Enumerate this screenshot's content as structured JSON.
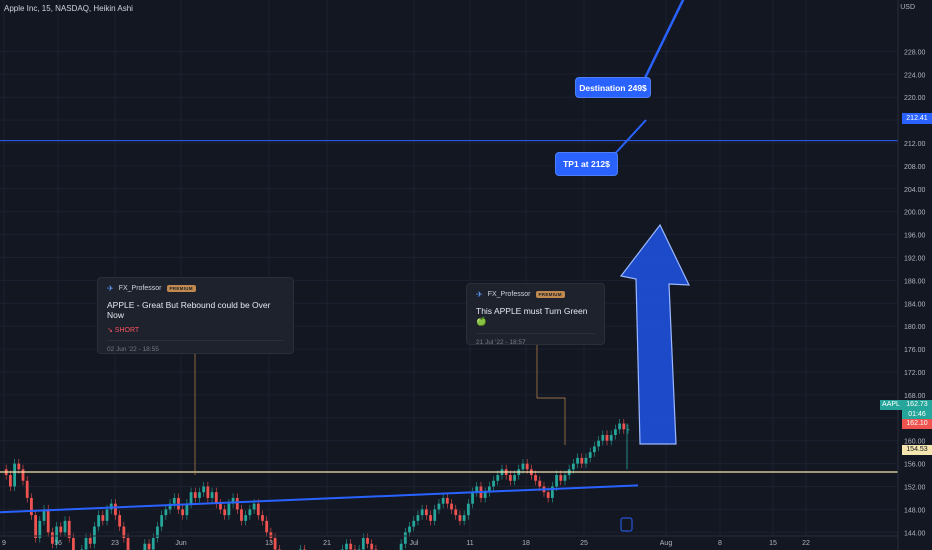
{
  "header": {
    "title": "Apple Inc, 15, NASDAQ, Heikin Ashi",
    "currency": "USD"
  },
  "colors": {
    "background": "#131722",
    "up": "#26a69a",
    "down": "#ef5350",
    "trendline": "#2962ff",
    "arrow": "#1e53e5",
    "support": "#f5e6b0",
    "level": "#2962ff"
  },
  "callouts": [
    {
      "author": "FX_Professor",
      "badge": "PREMIUM",
      "title": "APPLE - Great But Rebound could be Over Now",
      "signal": "↘ SHORT",
      "date": "02 Jun '22 - 18:55"
    },
    {
      "author": "FX_Professor",
      "badge": "PREMIUM",
      "title": "This APPLE must Turn Green 🍏",
      "signal": "",
      "date": "21 Jul '22 - 18:57"
    }
  ],
  "annotations": {
    "destination": "Destination 249$",
    "tp1": "TP1 at 212$"
  },
  "price_tags": {
    "level": "212.41",
    "symbol": "AAPL",
    "last": "162.73",
    "countdown": "01:46",
    "prev": "162.10",
    "support": "154.53"
  },
  "chart_data": {
    "type": "candlestick",
    "style": "Heikin Ashi",
    "symbol": "AAPL",
    "timeframe": "15",
    "exchange": "NASDAQ",
    "y_axis_ticks": [
      228,
      224,
      220,
      216,
      212,
      208,
      204,
      200,
      196,
      192,
      188,
      184,
      180,
      176,
      172,
      168,
      164,
      160,
      156,
      152,
      148,
      144,
      140
    ],
    "y_axis_labels": [
      "228.00",
      "224.00",
      "220.00",
      "216.00",
      "212.00",
      "208.00",
      "204.00",
      "200.00",
      "196.00",
      "192.00",
      "188.00",
      "184.00",
      "180.00",
      "176.00",
      "172.00",
      "168.00",
      "164.00",
      "160.00",
      "156.00",
      "152.00",
      "148.00",
      "144.00",
      "140.00"
    ],
    "ylim": [
      139.6,
      231.2
    ],
    "x_axis_labels": [
      "9",
      "16",
      "23",
      "Jun",
      "13",
      "21",
      "Jul",
      "11",
      "18",
      "25",
      "Aug",
      "8",
      "15",
      "22"
    ],
    "horizontal_lines": [
      212.41,
      154.53
    ],
    "trendline": {
      "from": [
        "9 May",
        147.5
      ],
      "to": [
        "29 Jul",
        152.2
      ]
    },
    "price_path_days": [
      0,
      2,
      4,
      6,
      8,
      10,
      12,
      14,
      16,
      18,
      20,
      22,
      24,
      26,
      28,
      30,
      32,
      34,
      36,
      38,
      40,
      42,
      44,
      46,
      48,
      50,
      52,
      54,
      56,
      58,
      60,
      62,
      64,
      66,
      68,
      70,
      72,
      74,
      76,
      78,
      80,
      82,
      84,
      86,
      88,
      90,
      92,
      94,
      96,
      98,
      100,
      102,
      104,
      106,
      108,
      110,
      112,
      114,
      116,
      118,
      120,
      122,
      124,
      126,
      128,
      130,
      132,
      134,
      136,
      138,
      140,
      142,
      144,
      146,
      148,
      150,
      152,
      154,
      156,
      158,
      160,
      162,
      164,
      166,
      168,
      170,
      172,
      174,
      176,
      178,
      180,
      182,
      184,
      186,
      188,
      190,
      192,
      194,
      196,
      198,
      200,
      202,
      204,
      206,
      208,
      210,
      212,
      214,
      216,
      218,
      220,
      222,
      224,
      226,
      228,
      230,
      232,
      234,
      236,
      238,
      240,
      242,
      244,
      246,
      248,
      250,
      252,
      254,
      256,
      258,
      260,
      262,
      264,
      266,
      268,
      270,
      272,
      274,
      276,
      278,
      280,
      282,
      284,
      286,
      288,
      290,
      292,
      294,
      296,
      298
    ],
    "price_path": [
      155,
      154,
      152,
      156,
      155,
      153,
      150,
      147,
      143,
      146,
      148,
      144,
      142,
      145,
      144,
      146,
      143,
      140,
      138,
      141,
      143,
      142,
      145,
      147,
      146,
      148,
      149,
      147,
      145,
      143,
      140,
      139,
      138,
      140,
      142,
      141,
      143,
      145,
      147,
      148,
      149,
      150,
      148,
      147,
      149,
      151,
      150,
      151,
      152,
      150,
      151,
      149,
      148,
      147,
      149,
      150,
      148,
      146,
      147,
      148,
      149,
      147,
      146,
      144,
      143,
      141,
      140,
      138,
      137,
      139,
      140,
      141,
      140,
      139,
      138,
      139,
      140,
      139,
      138,
      139,
      140,
      141,
      142,
      141,
      140,
      141,
      143,
      142,
      141,
      140,
      139,
      138,
      138,
      139,
      140,
      142,
      144,
      145,
      146,
      147,
      148,
      147,
      146,
      148,
      149,
      150,
      149,
      148,
      147,
      146,
      147,
      149,
      151,
      152,
      150,
      151,
      152,
      153,
      154,
      155,
      154,
      153,
      154,
      155,
      156,
      155,
      154,
      153,
      152,
      151,
      150,
      152,
      154,
      153,
      154,
      155,
      156,
      157,
      156,
      157,
      158,
      159,
      160,
      161,
      160,
      161,
      162,
      163,
      162,
      162
    ]
  }
}
